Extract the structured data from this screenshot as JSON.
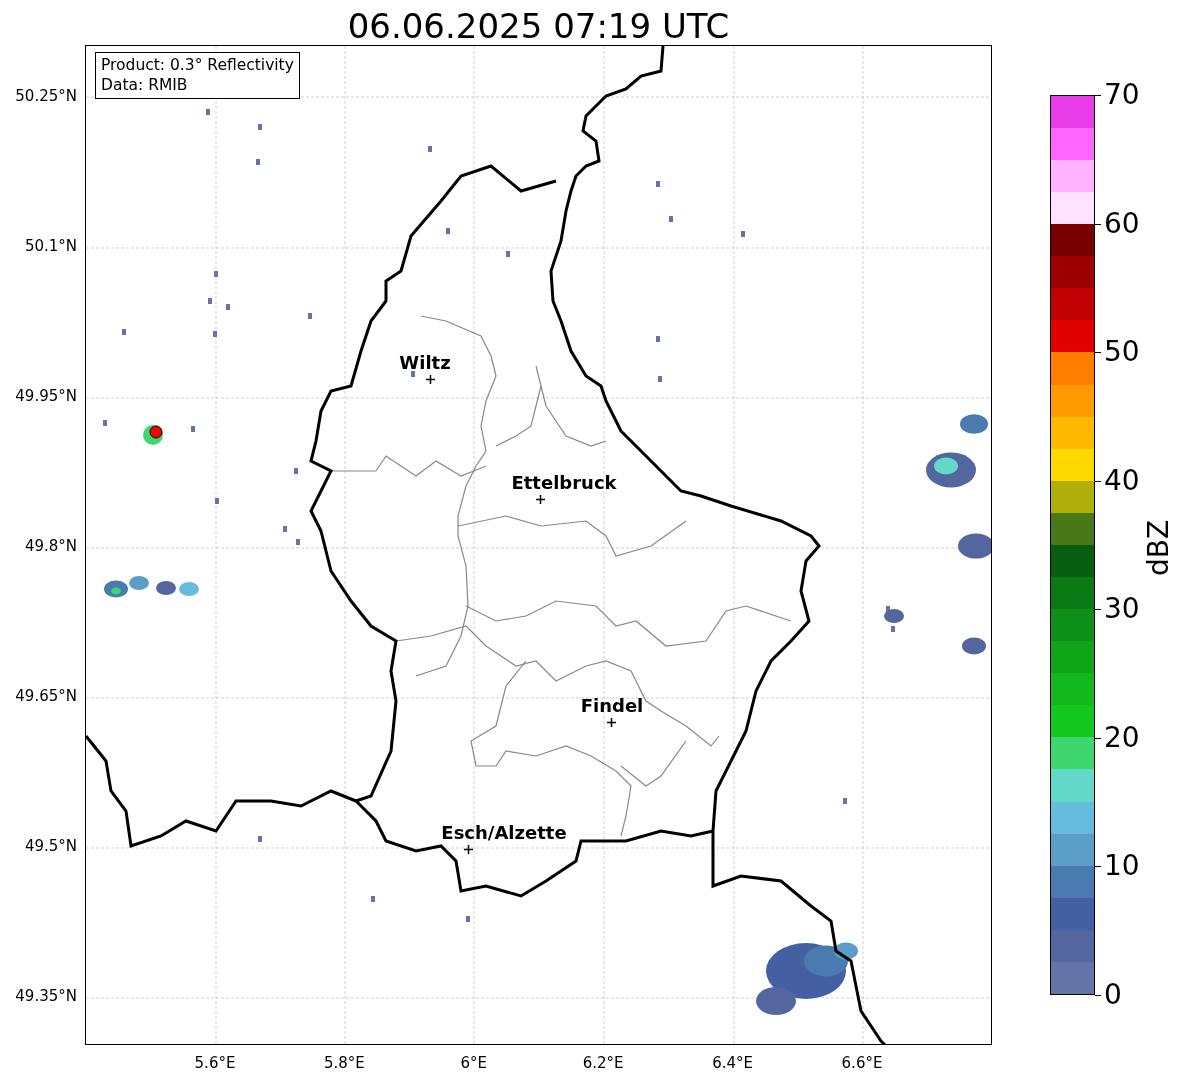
{
  "title": "06.06.2025 07:19 UTC",
  "legend": [
    "Product: 0.3° Reflectivity",
    "Data: RMIB"
  ],
  "map": {
    "cities": [
      {
        "name": "Wiltz"
      },
      {
        "name": "Ettelbruck"
      },
      {
        "name": "Findel"
      },
      {
        "name": "Esch/Alzette"
      }
    ],
    "yticks": [
      "50.25°N",
      "50.1°N",
      "49.95°N",
      "49.8°N",
      "49.65°N",
      "49.5°N",
      "49.35°N"
    ],
    "xticks": [
      "5.6°E",
      "5.8°E",
      "6°E",
      "6.2°E",
      "6.4°E",
      "6.6°E"
    ]
  },
  "colorbar": {
    "label": "dBZ",
    "ticks": [
      "70",
      "60",
      "50",
      "40",
      "30",
      "20",
      "10",
      "0"
    ],
    "segments": [
      {
        "color": "#6574a8"
      },
      {
        "color": "#5466a0"
      },
      {
        "color": "#4560a2"
      },
      {
        "color": "#4a7ab0"
      },
      {
        "color": "#5b9ec8"
      },
      {
        "color": "#66bcdc"
      },
      {
        "color": "#62d8c8"
      },
      {
        "color": "#3ed66e"
      },
      {
        "color": "#12c81f"
      },
      {
        "color": "#12b81c"
      },
      {
        "color": "#10a418"
      },
      {
        "color": "#0e9018"
      },
      {
        "color": "#0b7a14"
      },
      {
        "color": "#085e10"
      },
      {
        "color": "#487818"
      },
      {
        "color": "#b0b00c"
      },
      {
        "color": "#ffd800"
      },
      {
        "color": "#ffb800"
      },
      {
        "color": "#ff9a00"
      },
      {
        "color": "#ff7e00"
      },
      {
        "color": "#e00000"
      },
      {
        "color": "#c00000"
      },
      {
        "color": "#9c0000"
      },
      {
        "color": "#780000"
      },
      {
        "color": "#ffe2ff"
      },
      {
        "color": "#ffb2ff"
      },
      {
        "color": "#ff66ff"
      },
      {
        "color": "#e83ce8"
      }
    ]
  }
}
